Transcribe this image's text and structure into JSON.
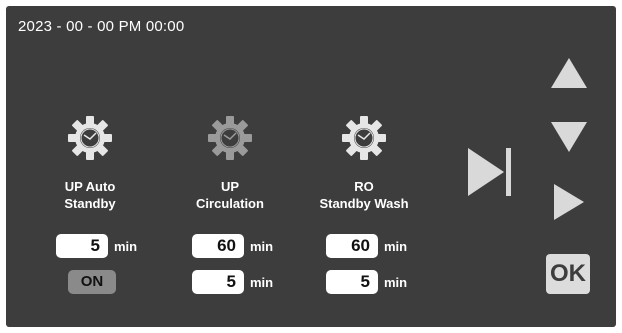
{
  "datetime": "2023 - 00 - 00 PM 00:00",
  "colors": {
    "background": "#3d3d3d",
    "gear_active": "#e6e6e6",
    "gear_inactive": "#9a9a9a",
    "toggle": "#8a8a8a",
    "arrow": "#d9d9d9"
  },
  "columns": [
    {
      "name": "up-auto-standby",
      "label_line1": "UP Auto",
      "label_line2": "Standby",
      "gear_icon": "gear-clock-icon",
      "field1_value": "5",
      "field1_unit": "min",
      "toggle_label": "ON"
    },
    {
      "name": "up-circulation",
      "label_line1": "UP",
      "label_line2": "Circulation",
      "gear_icon": "gear-clock-icon",
      "field1_value": "60",
      "field1_unit": "min",
      "field2_value": "5",
      "field2_unit": "min"
    },
    {
      "name": "ro-standby-wash",
      "label_line1": "RO",
      "label_line2": "Standby Wash",
      "gear_icon": "gear-clock-icon",
      "field1_value": "60",
      "field1_unit": "min",
      "field2_value": "5",
      "field2_unit": "min"
    }
  ],
  "controls": {
    "skip_icon": "skip-next-icon",
    "up_icon": "arrow-up-icon",
    "down_icon": "arrow-down-icon",
    "right_icon": "arrow-right-icon",
    "ok_label": "OK"
  }
}
